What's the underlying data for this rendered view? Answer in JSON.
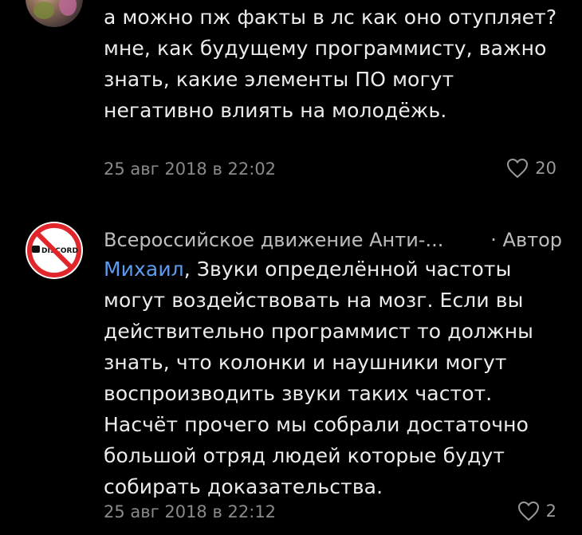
{
  "comments": [
    {
      "text": "а можно пж факты в лс как оно отупляет? мне, как будущему программисту, важно знать, какие элементы ПО могут негативно влиять на молодёжь.",
      "date": "25 авг 2018 в 22:02",
      "likes": "20",
      "avatar_icon": "user-photo-avatar"
    },
    {
      "author": "Всероссийское движение Анти-...",
      "author_badge": "· Автор",
      "mention": "Михаил",
      "text": ", Звуки определённой частоты могут воздействовать на мозг. Если вы действительно программист то должны знать, что колонки и наушники могут воспроизводить звуки таких частот. Насчёт прочего мы собрали достаточно большой отряд людей которые будут собирать доказательства.",
      "date": "25 авг 2018 в 22:12",
      "likes": "2",
      "avatar_icon": "no-discord-logo",
      "avatar_logo_text": "DISCORD"
    }
  ],
  "colors": {
    "background": "#000000",
    "text": "#ececec",
    "meta": "#8a8a8a",
    "mention": "#5b9cf0",
    "prohibition_red": "#e0262b"
  }
}
